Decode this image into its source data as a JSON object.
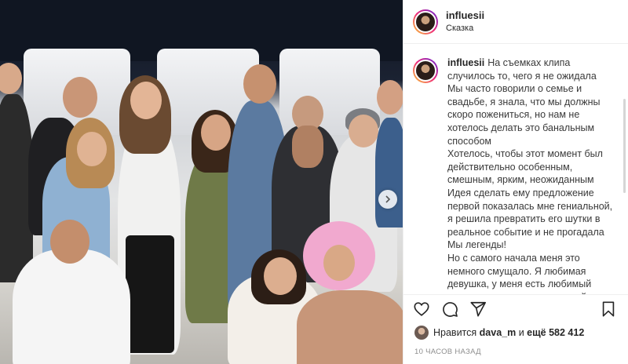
{
  "post": {
    "username": "influesii",
    "location": "Сказка",
    "caption_user": "influesii",
    "caption_text": "На съемках клипа случилось то, чего я не ожидала\nМы часто говорили о семье и свадьбе, я знала, что мы должны скоро пожениться, но нам не хотелось делать это банальным способом\nХотелось, чтобы этот момент был действительно особенным, смешным, ярким, неожиданным\nИдея сделать ему предложение первой показалась мне гениальной, я решила превратить его шутки в реальное событие и не прогадала\nМы легенды!\nНо с самого начала меня это немного смущало. Я любимая девушка, у меня есть любимый мужчина, я из консервативной",
    "likes_prefix": "Нравится",
    "likes_user": "dava_m",
    "likes_middle": "и",
    "likes_count": "ещё 582 412",
    "time_ago": "10 часов назад"
  },
  "icons": {
    "like": "heart-icon",
    "comment": "comment-icon",
    "share": "paper-plane-icon",
    "save": "bookmark-icon",
    "next": "chevron-right-icon"
  },
  "colors": {
    "text": "#262626",
    "muted": "#8e8e8e",
    "border": "#efefef",
    "story_ring": [
      "#f9ce34",
      "#ee2a7b",
      "#6228d7"
    ]
  }
}
